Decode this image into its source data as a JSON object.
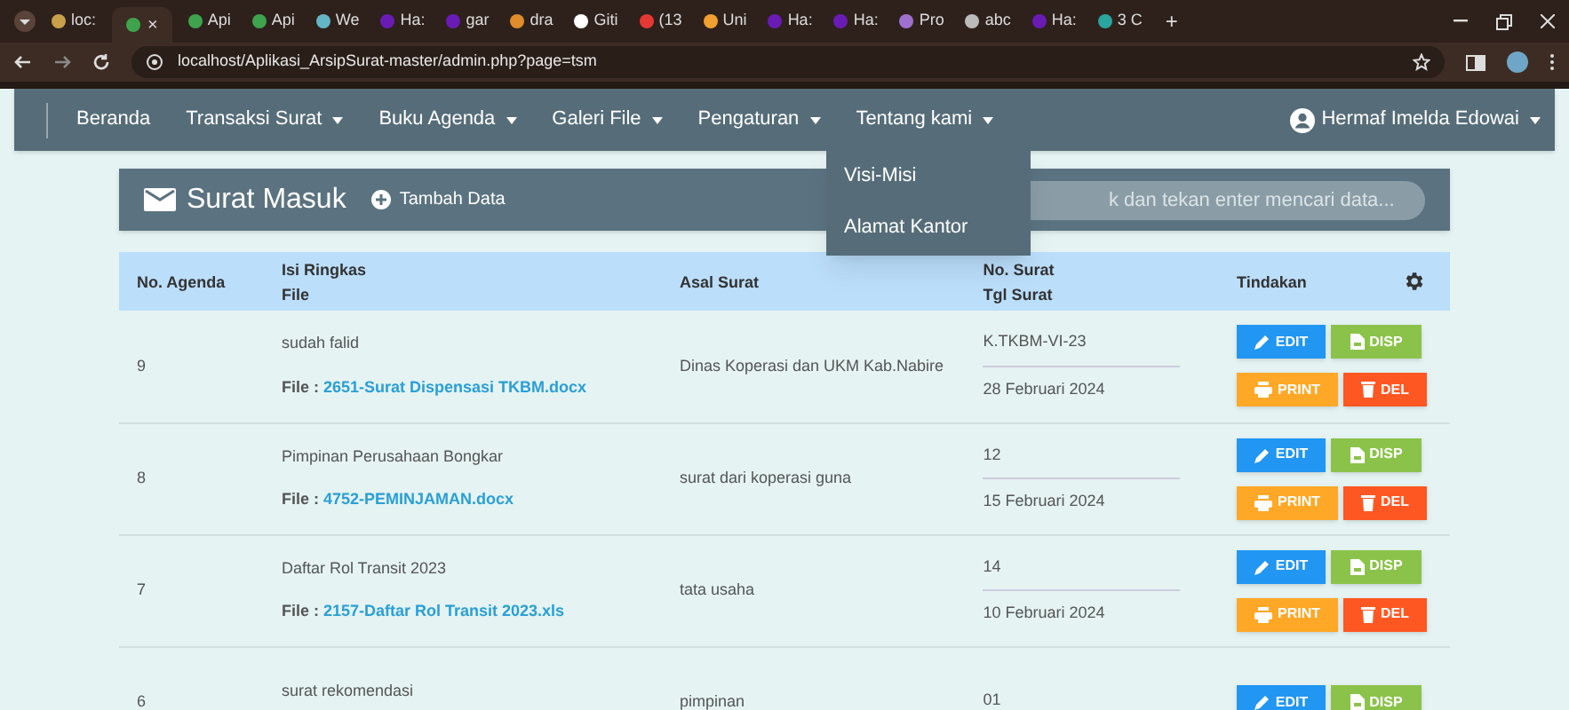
{
  "browser": {
    "tabs": [
      {
        "label": "loc:",
        "selected": false
      },
      {
        "selected": true
      },
      {
        "label": "Api",
        "selected": false
      },
      {
        "label": "Api",
        "selected": false
      },
      {
        "label": "We",
        "selected": false
      },
      {
        "label": "Ha:",
        "selected": false
      },
      {
        "label": "gar",
        "selected": false
      },
      {
        "label": "dra",
        "selected": false
      },
      {
        "label": "Giti",
        "selected": false
      },
      {
        "label": "(13",
        "selected": false
      },
      {
        "label": "Uni",
        "selected": false
      },
      {
        "label": "Ha:",
        "selected": false
      },
      {
        "label": "Ha:",
        "selected": false
      },
      {
        "label": "Pro",
        "selected": false
      },
      {
        "label": "abc",
        "selected": false
      },
      {
        "label": "Ha:",
        "selected": false
      },
      {
        "label": "3 C",
        "selected": false
      }
    ],
    "close_tab": "×",
    "new_tab": "+",
    "url": "localhost/Aplikasi_ArsipSurat-master/admin.php?page=tsm"
  },
  "navbar": {
    "items": [
      {
        "label": "Beranda",
        "dropdown": false
      },
      {
        "label": "Transaksi Surat",
        "dropdown": true
      },
      {
        "label": "Buku Agenda",
        "dropdown": true
      },
      {
        "label": "Galeri File",
        "dropdown": true
      },
      {
        "label": "Pengaturan",
        "dropdown": true
      },
      {
        "label": "Tentang kami",
        "dropdown": true
      }
    ],
    "user": "Hermaf Imelda Edowai",
    "open_menu": [
      "Visi-Misi",
      "Alamat Kantor"
    ]
  },
  "panel": {
    "title": "Surat Masuk",
    "add_button": "Tambah Data",
    "search": {
      "placeholder": "k dan tekan enter mencari data..."
    }
  },
  "table": {
    "columns": [
      [
        "No. Agenda"
      ],
      [
        "Isi Ringkas",
        "File"
      ],
      [
        "Asal Surat"
      ],
      [
        "No. Surat",
        "Tgl Surat"
      ],
      [
        "Tindakan"
      ]
    ],
    "rows": [
      {
        "no_agenda": "9",
        "summary": "sudah falid",
        "file_label": "File :",
        "file": "2651-Surat Dispensasi TKBM.docx",
        "asal": "Dinas Koperasi dan UKM Kab.Nabire",
        "no_surat": "K.TKBM-VI-23",
        "tgl": "28 Februari 2024",
        "buttons": [
          {
            "label": "EDIT",
            "kind": "edit"
          },
          {
            "label": "DISP",
            "kind": "disp"
          },
          {
            "label": "PRINT",
            "kind": "print"
          },
          {
            "label": "DEL",
            "kind": "del"
          }
        ]
      },
      {
        "no_agenda": "8",
        "summary": "Pimpinan Perusahaan Bongkar",
        "file_label": "File :",
        "file": "4752-PEMINJAMAN.docx",
        "asal": "surat dari koperasi guna",
        "no_surat": "12",
        "tgl": "15 Februari 2024",
        "buttons": [
          {
            "label": "EDIT",
            "kind": "edit"
          },
          {
            "label": "DISP",
            "kind": "disp"
          },
          {
            "label": "PRINT",
            "kind": "print"
          },
          {
            "label": "DEL",
            "kind": "del"
          }
        ]
      },
      {
        "no_agenda": "7",
        "summary": "Daftar Rol Transit 2023",
        "file_label": "File :",
        "file": "2157-Daftar Rol Transit 2023.xls",
        "asal": "tata usaha",
        "no_surat": "14",
        "tgl": "10 Februari 2024",
        "buttons": [
          {
            "label": "EDIT",
            "kind": "edit"
          },
          {
            "label": "DISP",
            "kind": "disp"
          },
          {
            "label": "PRINT",
            "kind": "print"
          },
          {
            "label": "DEL",
            "kind": "del"
          }
        ]
      },
      {
        "no_agenda": "6",
        "summary": "surat rekomendasi",
        "asal": "pimpinan",
        "no_surat": "01",
        "buttons": [
          {
            "label": "EDIT",
            "kind": "edit"
          },
          {
            "label": "DISP",
            "kind": "disp"
          }
        ]
      }
    ]
  }
}
